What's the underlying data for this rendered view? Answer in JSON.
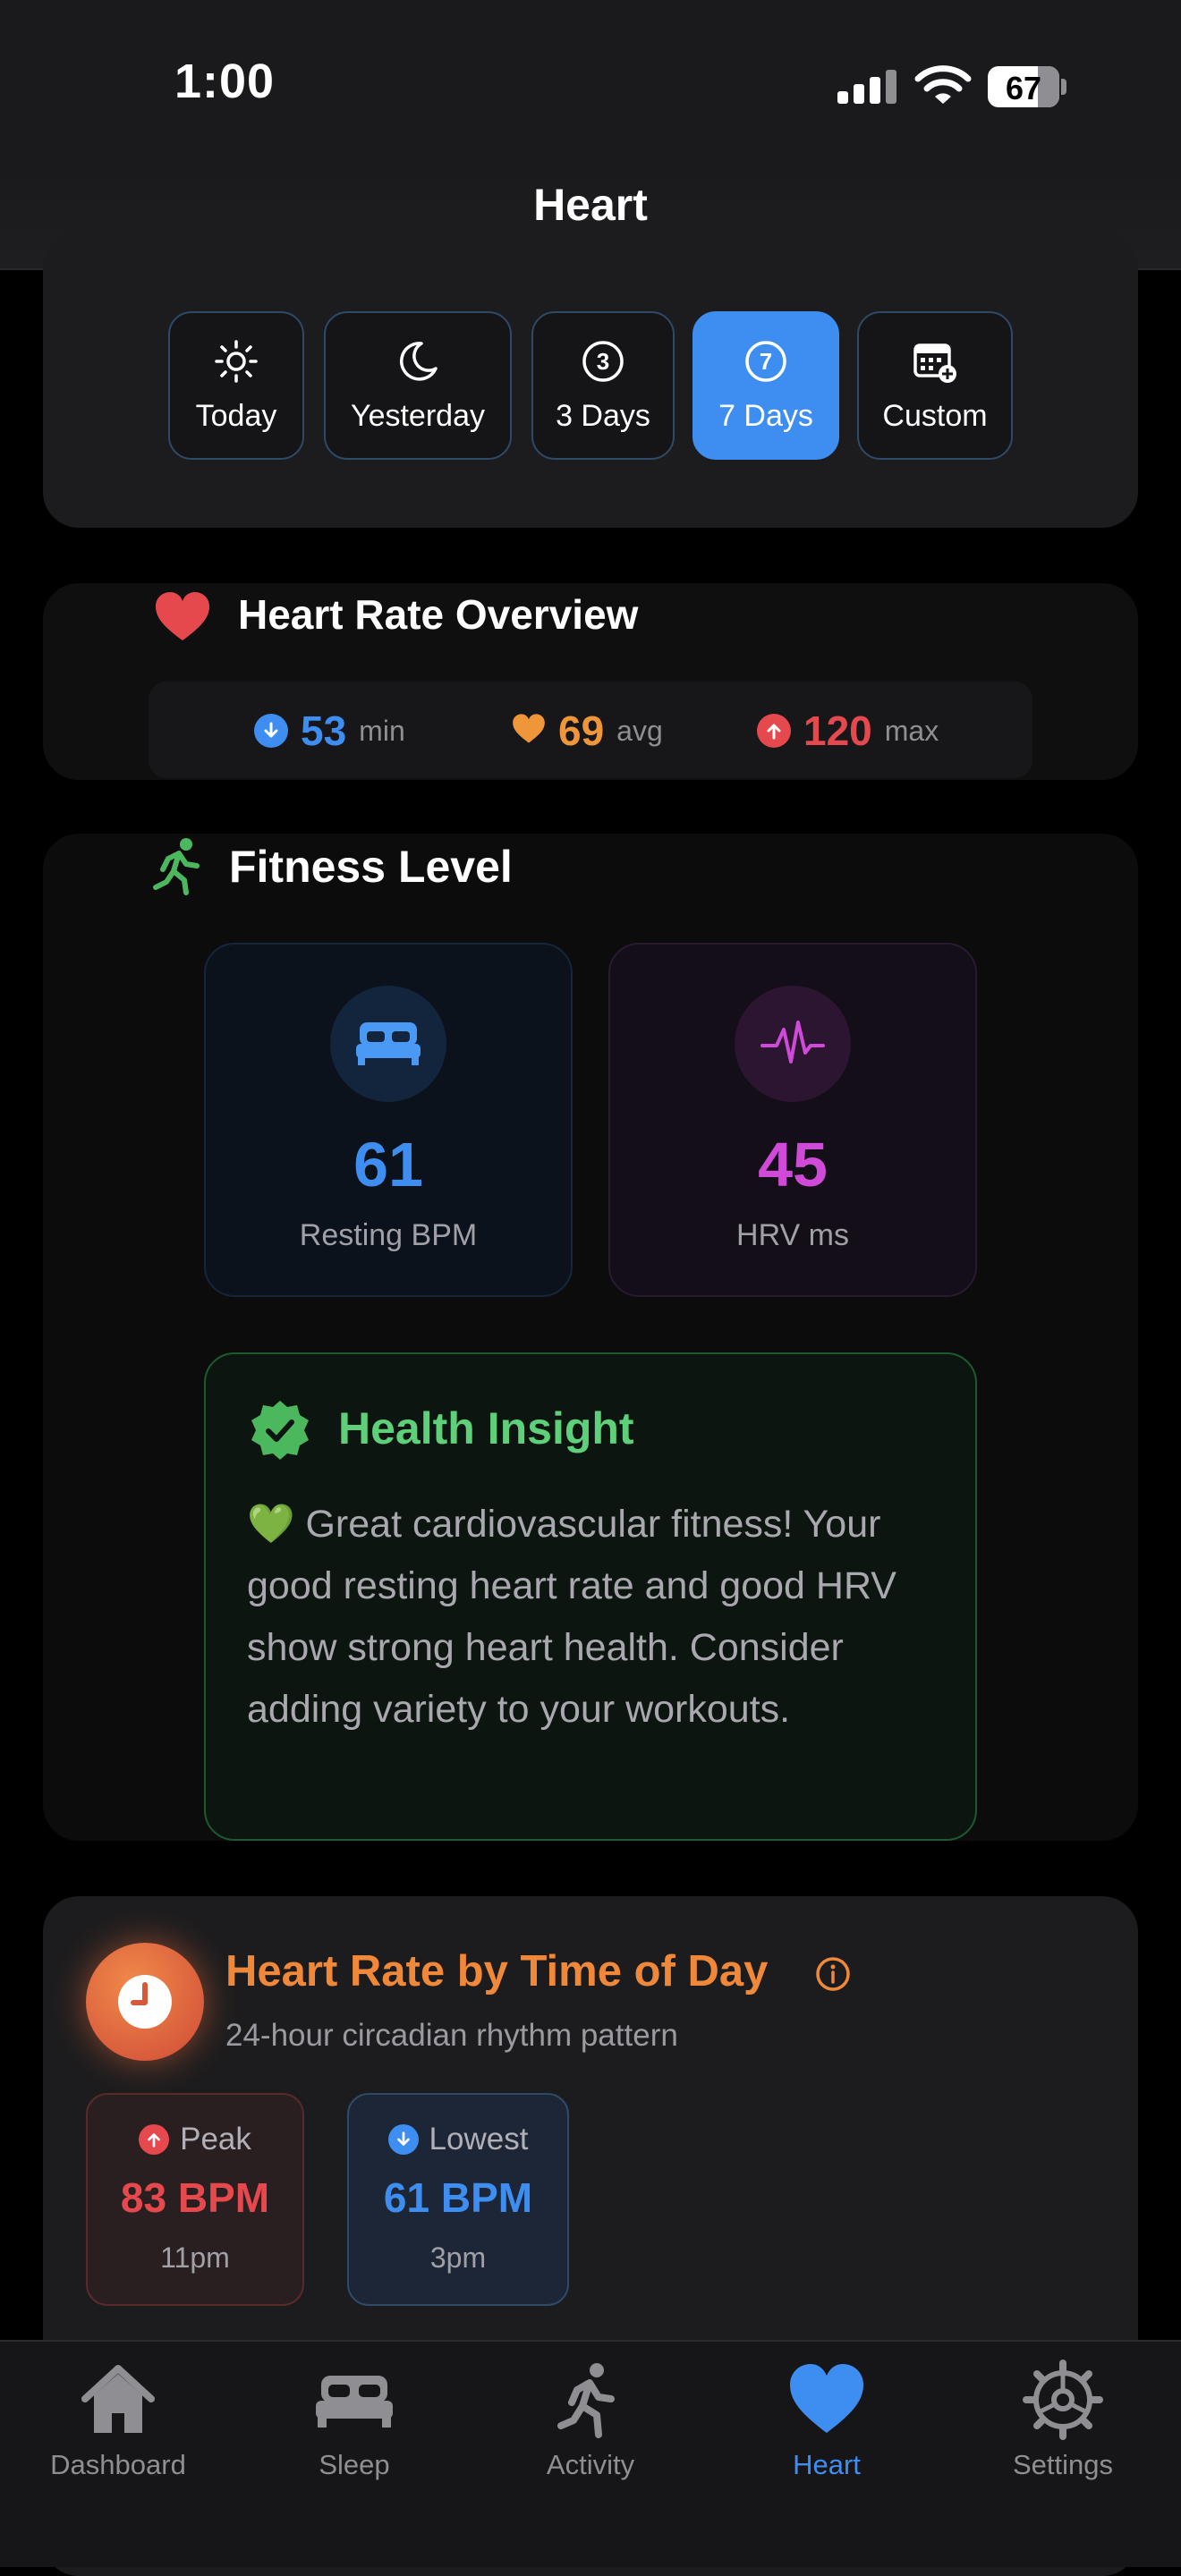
{
  "status": {
    "time": "1:00",
    "battery": "67"
  },
  "header": {
    "title": "Heart"
  },
  "ranges": [
    {
      "label": "Today",
      "icon": "sun-icon"
    },
    {
      "label": "Yesterday",
      "icon": "moon-icon"
    },
    {
      "label": "3 Days",
      "icon": "circle-3-icon"
    },
    {
      "label": "7 Days",
      "icon": "circle-7-icon",
      "active": true
    },
    {
      "label": "Custom",
      "icon": "calendar-plus-icon"
    }
  ],
  "overview": {
    "title": "Heart Rate Overview",
    "min": {
      "value": "53",
      "unit": "min"
    },
    "avg": {
      "value": "69",
      "unit": "avg"
    },
    "max": {
      "value": "120",
      "unit": "max"
    }
  },
  "fitness": {
    "title": "Fitness Level",
    "resting": {
      "value": "61",
      "caption": "Resting BPM"
    },
    "hrv": {
      "value": "45",
      "caption": "HRV ms"
    },
    "insight": {
      "title": "Health Insight",
      "text": "💚 Great cardiovascular fitness! Your good resting heart rate and good HRV show strong heart health. Consider adding variety to your workouts."
    }
  },
  "time_of_day": {
    "title": "Heart Rate by Time of Day",
    "subtitle": "24-hour circadian rhythm pattern",
    "peak": {
      "label": "Peak",
      "bpm": "83 BPM",
      "time": "11pm"
    },
    "lowest": {
      "label": "Lowest",
      "bpm": "61 BPM",
      "time": "3pm"
    }
  },
  "tabs": [
    {
      "label": "Dashboard"
    },
    {
      "label": "Sleep"
    },
    {
      "label": "Activity"
    },
    {
      "label": "Heart",
      "active": true
    },
    {
      "label": "Settings"
    }
  ],
  "colors": {
    "accent": "#3d8ef0",
    "heart": "#e5484d",
    "avg": "#f0963a",
    "hrv": "#d04ad8",
    "insight": "#5fd07a",
    "orange": "#f0883a"
  }
}
